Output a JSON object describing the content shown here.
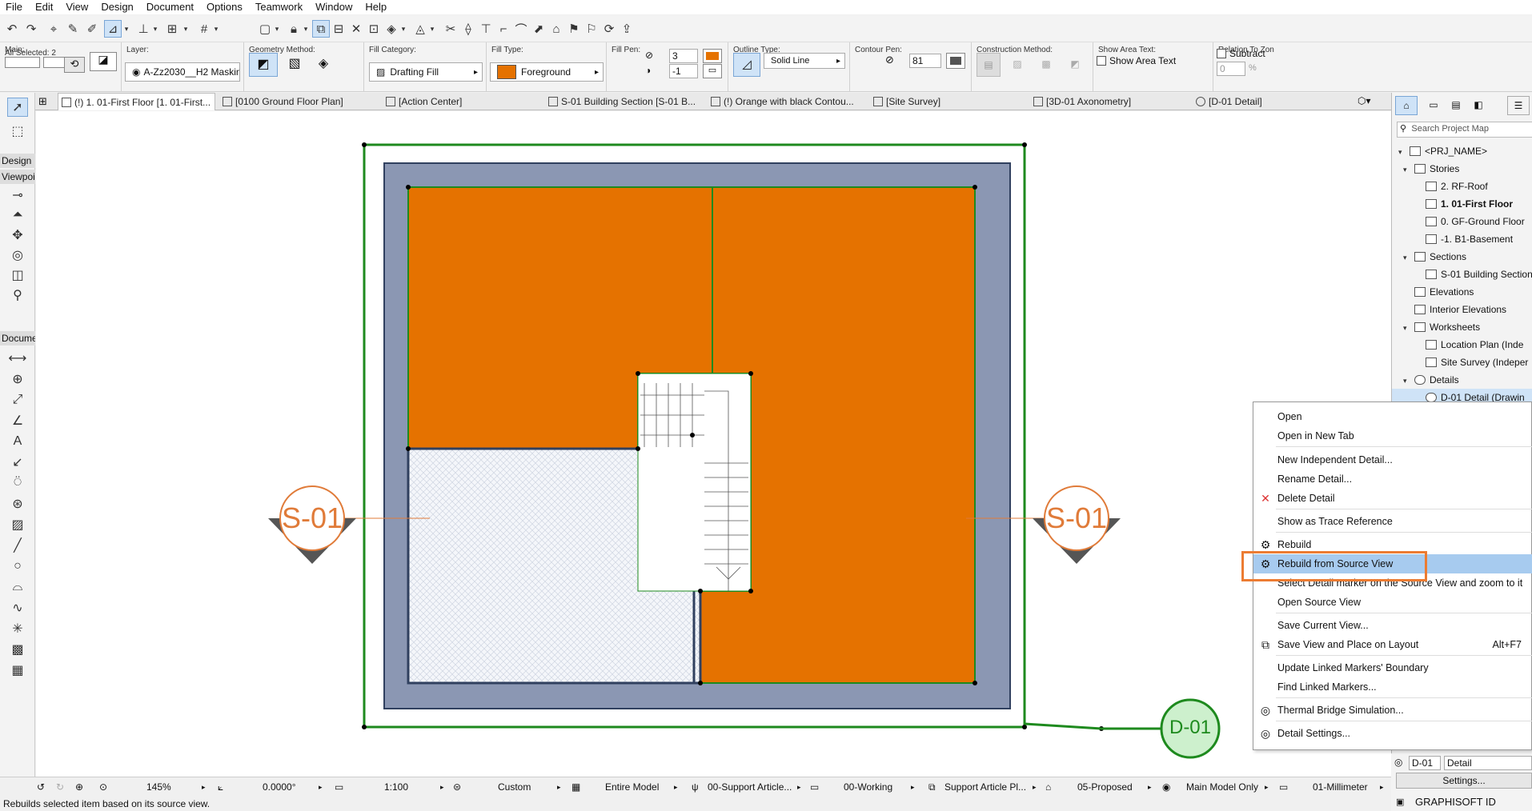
{
  "menu": [
    "File",
    "Edit",
    "View",
    "Design",
    "Document",
    "Options",
    "Teamwork",
    "Window",
    "Help"
  ],
  "info_box": {
    "main_label": "Main:",
    "all_selected": "All Selected: 2",
    "layer_label": "Layer:",
    "layer_value": "A-Zz2030__H2 Masking a...",
    "geometry_label": "Geometry Method:",
    "fill_category_label": "Fill Category:",
    "fill_category_value": "Drafting Fill",
    "fill_type_label": "Fill Type:",
    "fill_type_value": "Foreground",
    "fill_pen_label": "Fill Pen:",
    "fill_pen_value": "3",
    "fill_bg_value": "-1",
    "outline_label": "Outline Type:",
    "outline_value": "Solid Line",
    "contour_label": "Contour Pen:",
    "contour_value": "81",
    "construction_label": "Construction Method:",
    "show_area_label": "Show Area Text:",
    "show_area_text": "Show Area Text",
    "relation_label": "Relation To Zon",
    "subtract_label": "Subtract",
    "percent_value": "0",
    "percent_unit": "%"
  },
  "tabs": [
    {
      "label": "(!) 1. 01-First Floor [1. 01-First...",
      "close": "×"
    },
    {
      "label": "[0100 Ground Floor Plan]"
    },
    {
      "label": "[Action Center]"
    },
    {
      "label": "S-01 Building Section [S-01 B..."
    },
    {
      "label": "(!) Orange with black Contou..."
    },
    {
      "label": "[Site Survey]"
    },
    {
      "label": "[3D-01 Axonometry]"
    },
    {
      "label": "[D-01 Detail]"
    }
  ],
  "toolbox": {
    "design_header": "Design",
    "viewpoint_header": "Viewpoi",
    "document_header": "Docume"
  },
  "canvas": {
    "section_marker_left": "S-01",
    "section_marker_right": "S-01",
    "detail_marker": "D-01"
  },
  "navigator": {
    "search_placeholder": "Search Project Map",
    "items": [
      {
        "label": "<PRJ_NAME>",
        "level": 0,
        "twisty": "v"
      },
      {
        "label": "Stories",
        "level": 1,
        "twisty": "v"
      },
      {
        "label": "2. RF-Roof",
        "level": 2
      },
      {
        "label": "1. 01-First Floor",
        "level": 2,
        "bold": true
      },
      {
        "label": "0. GF-Ground Floor",
        "level": 2
      },
      {
        "label": "-1. B1-Basement",
        "level": 2
      },
      {
        "label": "Sections",
        "level": 1,
        "twisty": "v"
      },
      {
        "label": "S-01 Building Section",
        "level": 2
      },
      {
        "label": "Elevations",
        "level": 1
      },
      {
        "label": "Interior Elevations",
        "level": 1
      },
      {
        "label": "Worksheets",
        "level": 1,
        "twisty": "v"
      },
      {
        "label": "Location Plan (Inde",
        "level": 2
      },
      {
        "label": "Site Survey (Indeper",
        "level": 2
      },
      {
        "label": "Details",
        "level": 1,
        "twisty": "v"
      },
      {
        "label": "D-01 Detail (Drawin",
        "level": 2,
        "selected": true
      }
    ],
    "id_value": "D-01",
    "name_value": "Detail",
    "settings_button": "Settings...",
    "graphisoft_id": "GRAPHISOFT ID"
  },
  "context_menu": [
    {
      "label": "Open"
    },
    {
      "label": "Open in New Tab",
      "sep_after": true
    },
    {
      "label": "New Independent Detail..."
    },
    {
      "label": "Rename Detail..."
    },
    {
      "label": "Delete Detail",
      "icon": "delete-icon",
      "sep_after": true
    },
    {
      "label": "Show as Trace Reference",
      "sep_after": true
    },
    {
      "label": "Rebuild",
      "icon": "rebuild-icon"
    },
    {
      "label": "Rebuild from Source View",
      "icon": "rebuild-source-icon",
      "highlighted": true
    },
    {
      "label": "Select Detail marker on the Source View and zoom to it"
    },
    {
      "label": "Open Source View",
      "sep_after": true
    },
    {
      "label": "Save Current View..."
    },
    {
      "label": "Save View and Place on Layout",
      "shortcut": "Alt+F7",
      "icon": "place-layout-icon",
      "sep_after": true
    },
    {
      "label": "Update Linked Markers' Boundary"
    },
    {
      "label": "Find Linked Markers...",
      "sep_after": true
    },
    {
      "label": "Thermal Bridge Simulation...",
      "icon": "thermal-icon",
      "sep_after": true
    },
    {
      "label": "Detail Settings...",
      "icon": "detail-settings-icon"
    }
  ],
  "status": {
    "zoom": "145%",
    "angle": "0.0000°",
    "scale": "1:100",
    "structure": "Custom",
    "model_view": "Entire Model",
    "pen_set": "00-Support Article...",
    "working": "00-Working",
    "dimension": "Support Article Pl...",
    "renovation": "05-Proposed",
    "model_only": "Main Model Only",
    "unit": "01-Millimeter"
  },
  "hint": "Rebuilds selected item based on its source view.",
  "colors": {
    "fill_orange": "#e57200",
    "wall_blue": "#8b97b3",
    "outline_green": "#1e8a1e",
    "marker_orange": "#e07b39",
    "highlight": "#a7cbef",
    "hl_box": "#ec7c32"
  }
}
